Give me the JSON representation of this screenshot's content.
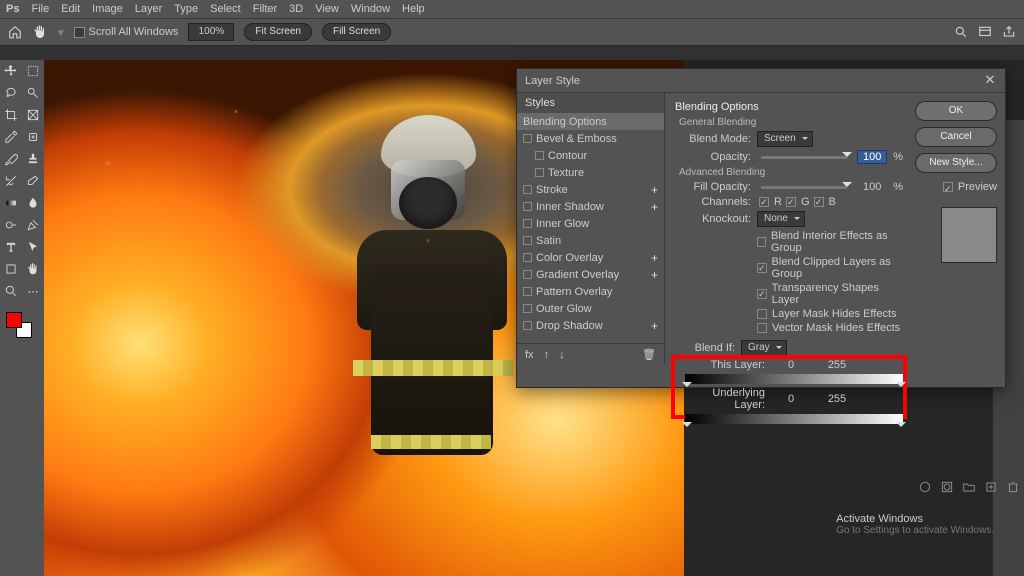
{
  "menu": {
    "ps": "Ps",
    "file": "File",
    "edit": "Edit",
    "image": "Image",
    "layer": "Layer",
    "type": "Type",
    "select": "Select",
    "filter": "Filter",
    "threeD": "3D",
    "view": "View",
    "window": "Window",
    "help": "Help"
  },
  "optbar": {
    "scrollAll": "Scroll All Windows",
    "zoom": "100%",
    "fitScreen": "Fit Screen",
    "fillScreen": "Fill Screen"
  },
  "dialog": {
    "title": "Layer Style",
    "stylesHead": "Styles",
    "items": {
      "blendingOptions": "Blending Options",
      "bevel": "Bevel & Emboss",
      "contour": "Contour",
      "texture": "Texture",
      "stroke": "Stroke",
      "innerShadow": "Inner Shadow",
      "innerGlow": "Inner Glow",
      "satin": "Satin",
      "colorOverlay": "Color Overlay",
      "gradientOverlay": "Gradient Overlay",
      "patternOverlay": "Pattern Overlay",
      "outerGlow": "Outer Glow",
      "dropShadow": "Drop Shadow"
    },
    "opts": {
      "blendingOptionsTitle": "Blending Options",
      "generalBlending": "General Blending",
      "blendMode": "Blend Mode:",
      "blendModeVal": "Screen",
      "opacity": "Opacity:",
      "opacityVal": "100",
      "advanced": "Advanced Blending",
      "fillOpacity": "Fill Opacity:",
      "fillOpacityVal": "100",
      "channels": "Channels:",
      "chR": "R",
      "chG": "G",
      "chB": "B",
      "knockout": "Knockout:",
      "knockoutVal": "None",
      "blendInterior": "Blend Interior Effects as Group",
      "blendClipped": "Blend Clipped Layers as Group",
      "transparency": "Transparency Shapes Layer",
      "layerMaskHides": "Layer Mask Hides Effects",
      "vectorMaskHides": "Vector Mask Hides Effects",
      "blendIf": "Blend If:",
      "blendIfVal": "Gray",
      "thisLayer": "This Layer:",
      "thisLow": "0",
      "thisHigh": "255",
      "underlying": "Underlying Layer:",
      "underLow": "0",
      "underHigh": "255"
    },
    "buttons": {
      "ok": "OK",
      "cancel": "Cancel",
      "newStyle": "New Style...",
      "preview": "Preview"
    }
  },
  "watermark": {
    "title": "Activate Windows",
    "sub": "Go to Settings to activate Windows."
  }
}
